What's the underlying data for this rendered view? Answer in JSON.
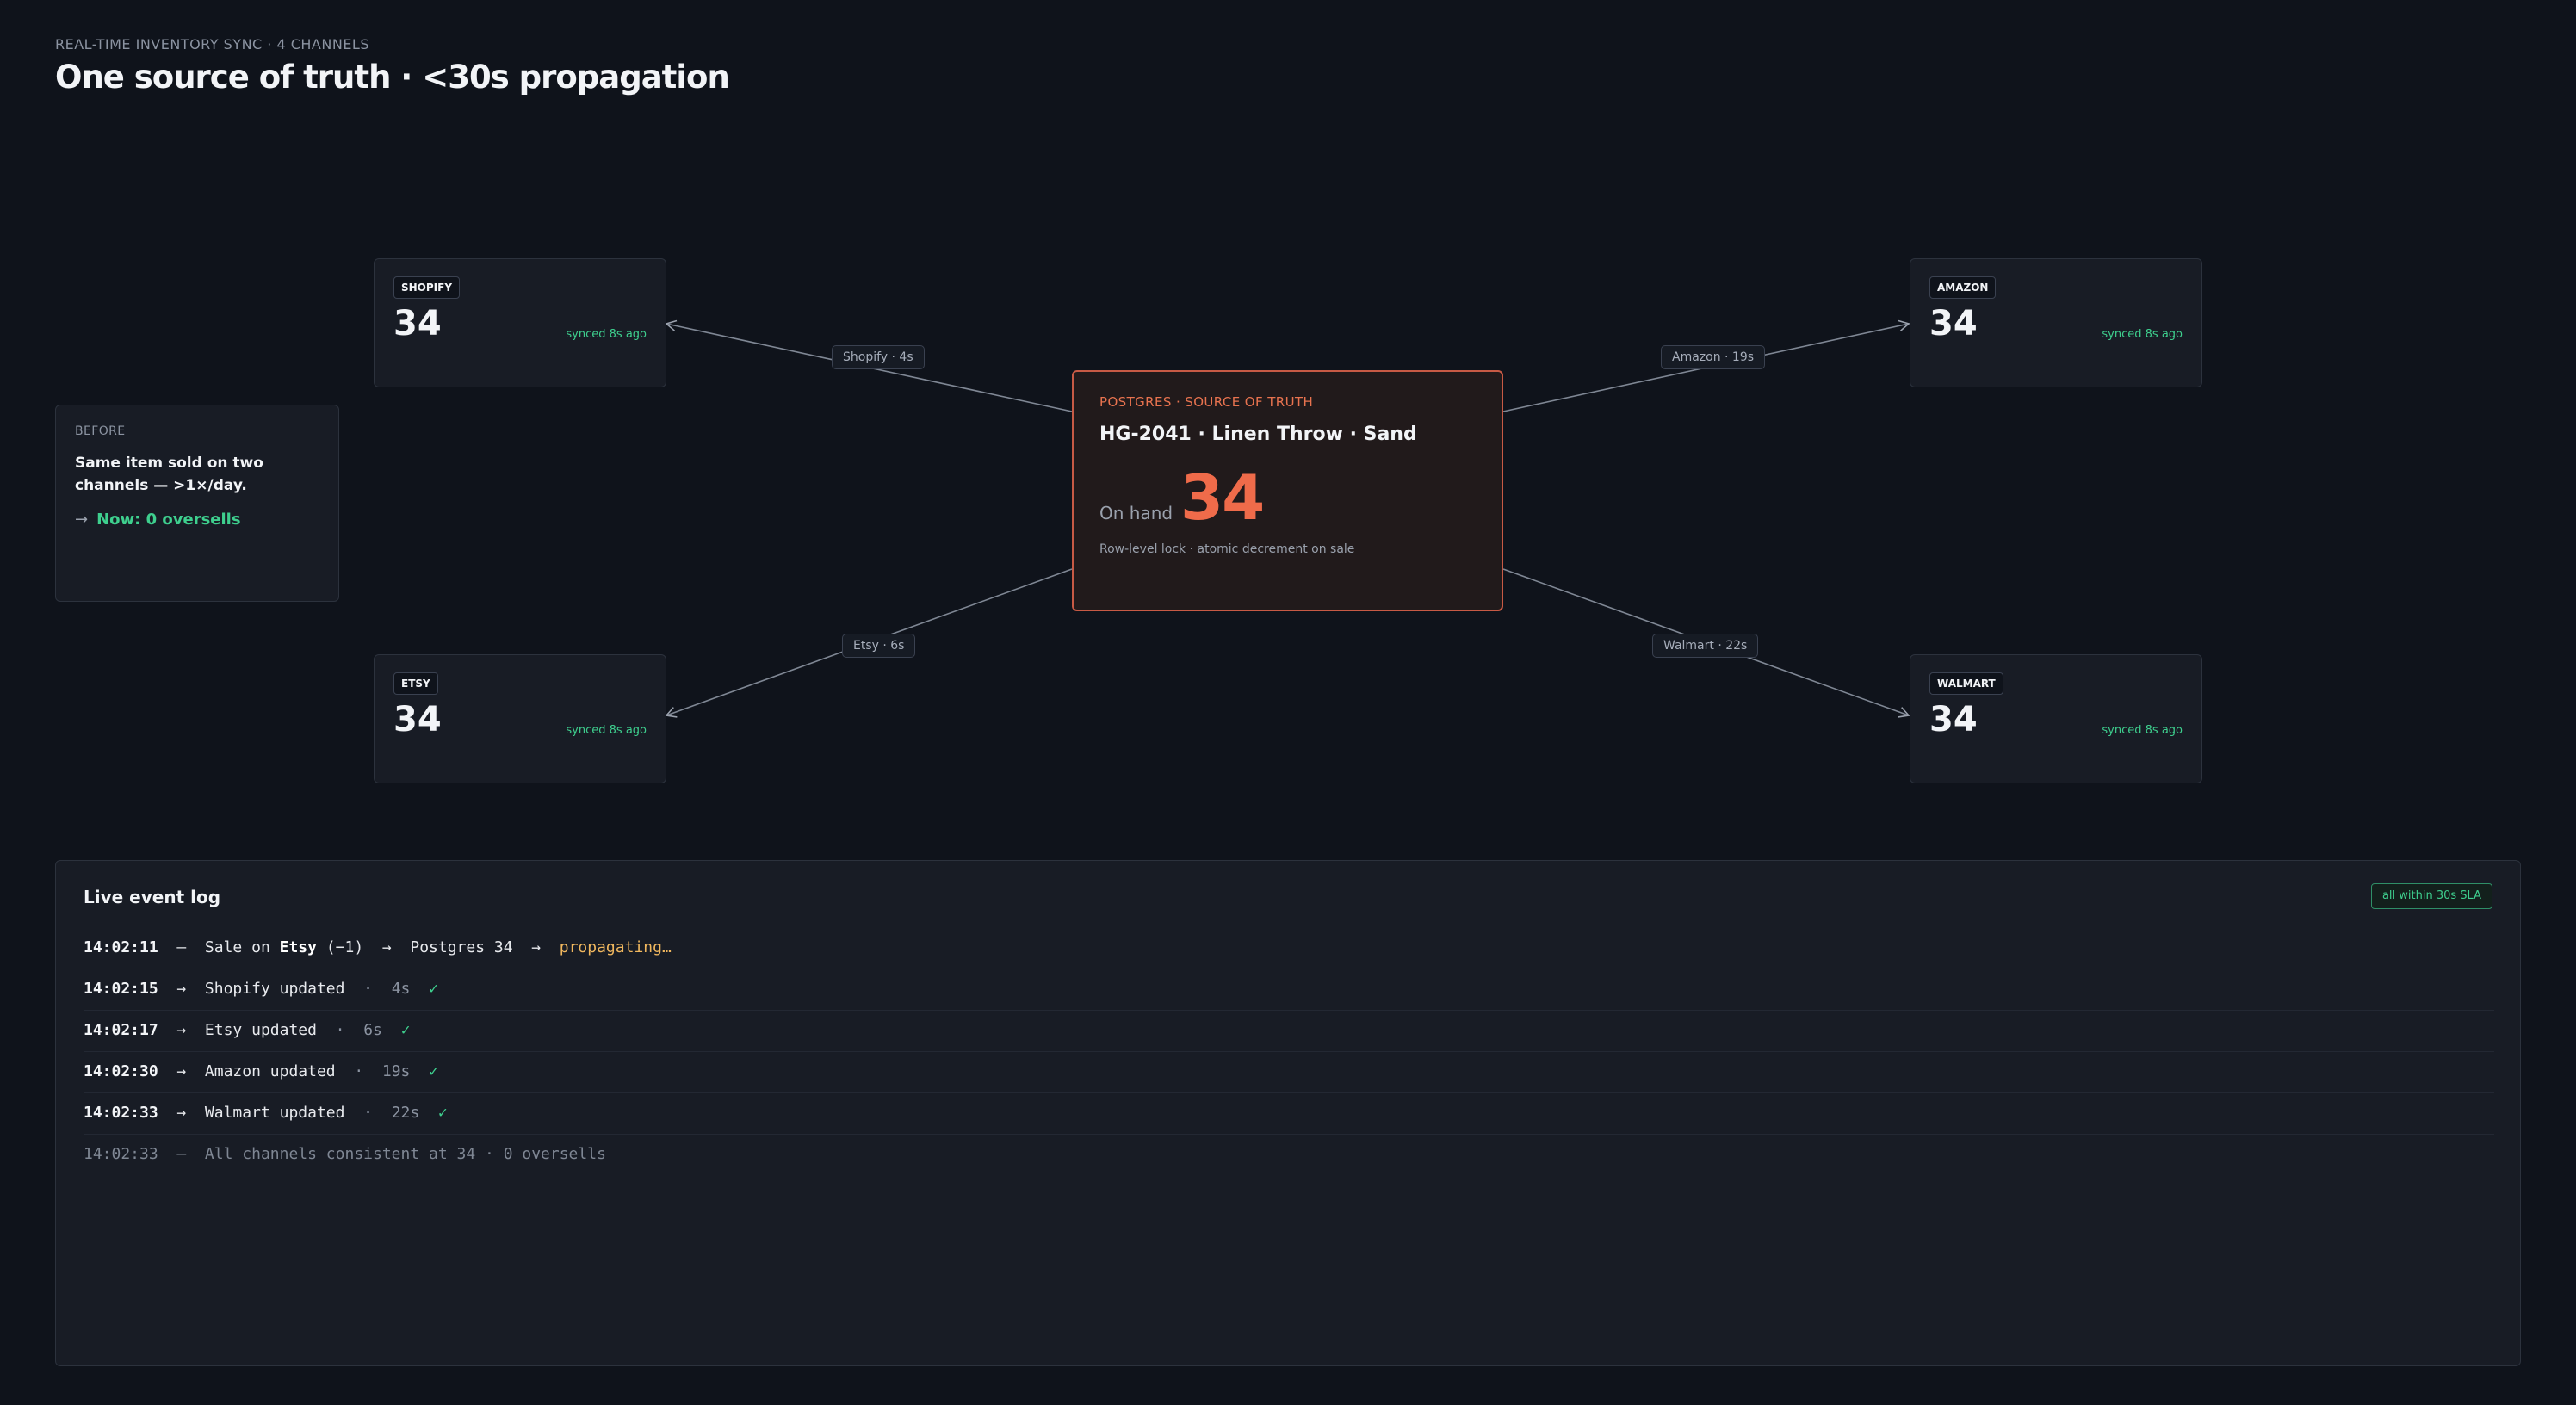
{
  "header": {
    "eyebrow": "REAL-TIME INVENTORY SYNC · 4 CHANNELS",
    "title": "One source of truth · <30s propagation"
  },
  "source": {
    "kicker": "POSTGRES · SOURCE OF TRUTH",
    "sku": "HG-2041 · Linen Throw · Sand",
    "on_hand_label": "On hand",
    "on_hand_value": "34",
    "note": "Row-level lock · atomic decrement on sale"
  },
  "channels": {
    "shopify": {
      "tag": "SHOPIFY",
      "qty": "34",
      "synced": "synced 8s ago",
      "edge_label": "Shopify · 4s"
    },
    "amazon": {
      "tag": "AMAZON",
      "qty": "34",
      "synced": "synced 8s ago",
      "edge_label": "Amazon · 19s"
    },
    "etsy": {
      "tag": "ETSY",
      "qty": "34",
      "synced": "synced 8s ago",
      "edge_label": "Etsy · 6s"
    },
    "walmart": {
      "tag": "WALMART",
      "qty": "34",
      "synced": "synced 8s ago",
      "edge_label": "Walmart · 22s"
    }
  },
  "before": {
    "label": "BEFORE",
    "text": "Same item sold on two channels — >1×/day.",
    "arrow": "→",
    "now": "Now: 0 oversells"
  },
  "log": {
    "title": "Live event log",
    "badge": "all within 30s SLA",
    "rows": [
      {
        "time": "14:02:11",
        "sep": "—",
        "pre": "Sale on ",
        "bold": "Etsy",
        "post": " (−1)  →  Postgres 34  →  ",
        "status": "propagating…"
      },
      {
        "time": "14:02:15",
        "sep": "→",
        "text": "Shopify updated",
        "dot": "·",
        "dur": "4s",
        "check": "✓"
      },
      {
        "time": "14:02:17",
        "sep": "→",
        "text": "Etsy updated",
        "dot": "·",
        "dur": "6s",
        "check": "✓"
      },
      {
        "time": "14:02:30",
        "sep": "→",
        "text": "Amazon updated",
        "dot": "·",
        "dur": "19s",
        "check": "✓"
      },
      {
        "time": "14:02:33",
        "sep": "→",
        "text": "Walmart updated",
        "dot": "·",
        "dur": "22s",
        "check": "✓"
      },
      {
        "time": "14:02:33",
        "sep": "—",
        "text": "All channels consistent at 34 · 0 oversells"
      }
    ]
  },
  "colors": {
    "background": "#0f131b",
    "accent": "#ef6b4a",
    "success": "#3ecf8e",
    "warning": "#f0b75e"
  }
}
